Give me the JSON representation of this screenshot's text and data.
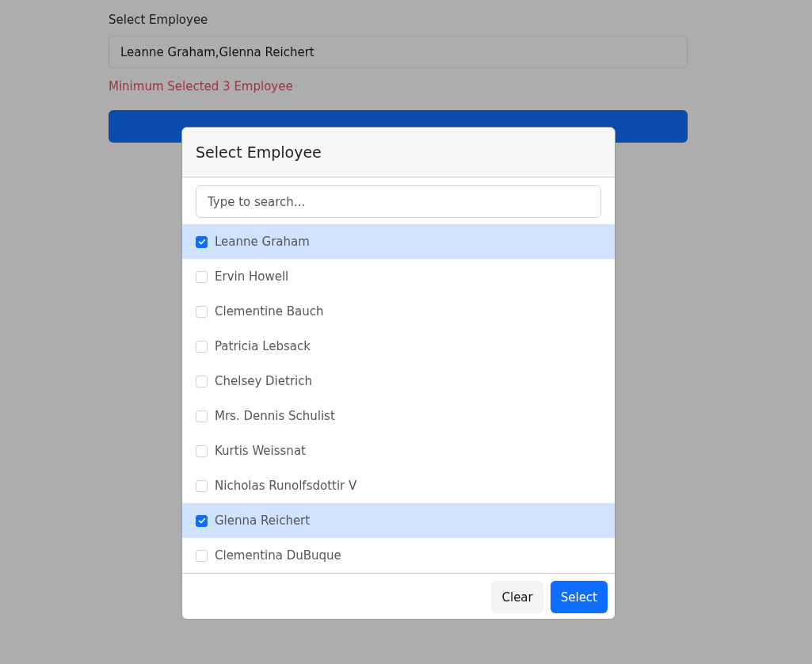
{
  "form": {
    "label": "Select Employee",
    "value": "Leanne Graham,Glenna Reichert",
    "error": "Minimum Selected 3 Employee"
  },
  "modal": {
    "title": "Select Employee",
    "search": {
      "placeholder": "Type to search..."
    },
    "employees": [
      {
        "name": "Leanne Graham",
        "selected": true
      },
      {
        "name": "Ervin Howell",
        "selected": false
      },
      {
        "name": "Clementine Bauch",
        "selected": false
      },
      {
        "name": "Patricia Lebsack",
        "selected": false
      },
      {
        "name": "Chelsey Dietrich",
        "selected": false
      },
      {
        "name": "Mrs. Dennis Schulist",
        "selected": false
      },
      {
        "name": "Kurtis Weissnat",
        "selected": false
      },
      {
        "name": "Nicholas Runolfsdottir V",
        "selected": false
      },
      {
        "name": "Glenna Reichert",
        "selected": true
      },
      {
        "name": "Clementina DuBuque",
        "selected": false
      }
    ],
    "buttons": [
      {
        "label": "Clear",
        "kind": "secondary"
      },
      {
        "label": "Select",
        "kind": "primary"
      }
    ]
  }
}
